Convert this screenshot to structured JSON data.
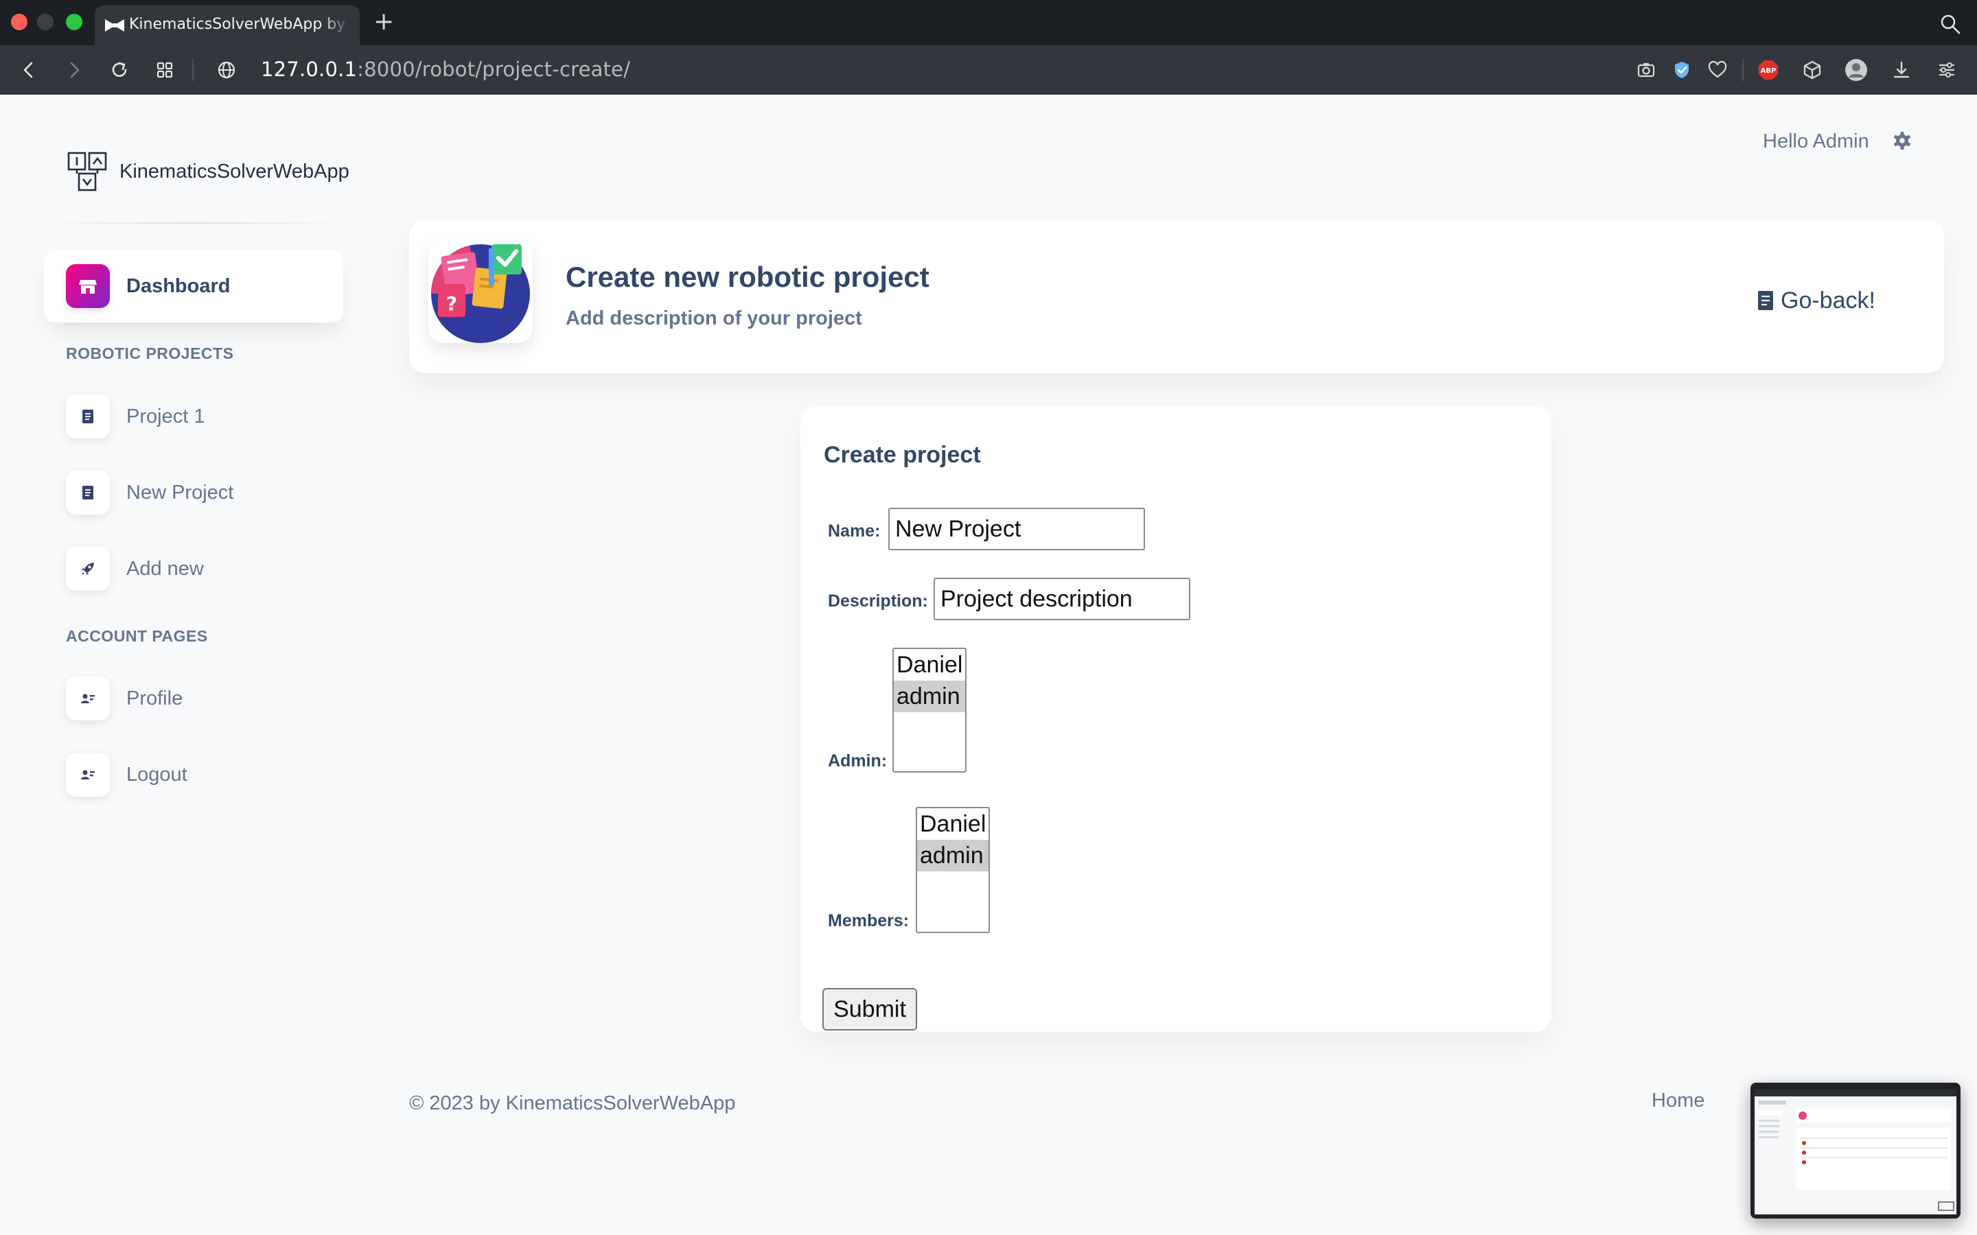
{
  "browser": {
    "tab_title": "KinematicsSolverWebApp by Daniel",
    "url_host": "127.0.0.1",
    "url_rest": ":8000/robot/project-create/"
  },
  "brand": {
    "name": "KinematicsSolverWebApp"
  },
  "sidebar": {
    "active_item": "Dashboard",
    "section_projects": "ROBOTIC PROJECTS",
    "projects": [
      {
        "label": "Project 1",
        "icon": "document-icon"
      },
      {
        "label": "New Project",
        "icon": "document-icon"
      },
      {
        "label": "Add new",
        "icon": "rocket-icon"
      }
    ],
    "section_account": "ACCOUNT PAGES",
    "account": [
      {
        "label": "Profile",
        "icon": "user-card-icon"
      },
      {
        "label": "Logout",
        "icon": "user-card-icon"
      }
    ]
  },
  "topbar": {
    "greeting": "Hello Admin"
  },
  "header": {
    "title": "Create new robotic project",
    "subtitle": "Add description of your project",
    "back_label": "Go-back!"
  },
  "form": {
    "title": "Create project",
    "name_label": "Name:",
    "name_value": "New Project",
    "description_label": "Description:",
    "description_value": "Project description",
    "admin_label": "Admin:",
    "admin_options": [
      "Daniel",
      "admin"
    ],
    "admin_selected": "admin",
    "members_label": "Members:",
    "members_options": [
      "Daniel",
      "admin"
    ],
    "members_selected": "admin",
    "submit_label": "Submit"
  },
  "footer": {
    "copyright": "© 2023 by KinematicsSolverWebApp",
    "home_link": "Home"
  },
  "colors": {
    "accent_gradient_start": "#7928ca",
    "accent_gradient_end": "#ff0080",
    "text_primary": "#344767",
    "text_secondary": "#67748e",
    "page_bg": "#f8f9fa"
  }
}
